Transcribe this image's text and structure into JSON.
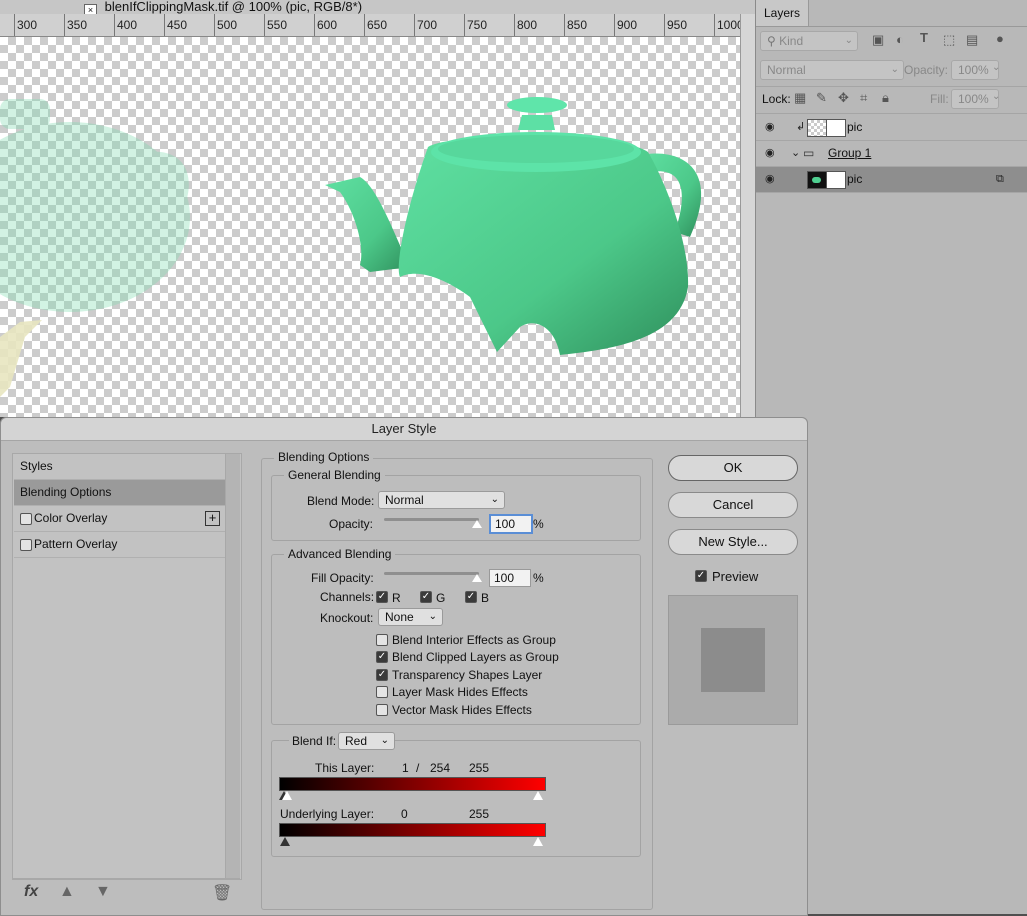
{
  "document": {
    "title": "blenIfClippingMask.tif @ 100% (pic, RGB/8*)"
  },
  "ruler": {
    "ticks": [
      "300",
      "350",
      "400",
      "450",
      "500",
      "550",
      "600",
      "650",
      "700",
      "750",
      "800",
      "850",
      "900",
      "950",
      "1000"
    ]
  },
  "layers_panel": {
    "tab": "Layers",
    "filter_kind": "Kind",
    "blend_mode": "Normal",
    "opacity_label": "Opacity:",
    "opacity_value": "100%",
    "lock_label": "Lock:",
    "fill_label": "Fill:",
    "fill_value": "100%",
    "layers": [
      {
        "name": "pic",
        "clipped": true
      },
      {
        "name": "Group 1",
        "is_group": true
      },
      {
        "name": "pic",
        "selected": true
      }
    ]
  },
  "dialog": {
    "title": "Layer Style",
    "styles": [
      {
        "label": "Styles"
      },
      {
        "label": "Blending Options",
        "selected": true
      },
      {
        "label": "Color Overlay",
        "checked": false
      },
      {
        "label": "Pattern Overlay",
        "checked": false
      }
    ],
    "blending_options": {
      "header": "Blending Options",
      "general": {
        "legend": "General Blending",
        "blend_mode_label": "Blend Mode:",
        "blend_mode": "Normal",
        "opacity_label": "Opacity:",
        "opacity": "100",
        "unit": "%"
      },
      "advanced": {
        "legend": "Advanced Blending",
        "fill_label": "Fill Opacity:",
        "fill": "100",
        "unit": "%",
        "channels_label": "Channels:",
        "channels": [
          "R",
          "G",
          "B"
        ],
        "knockout_label": "Knockout:",
        "knockout": "None",
        "options": [
          {
            "label": "Blend Interior Effects as Group",
            "checked": false
          },
          {
            "label": "Blend Clipped Layers as Group",
            "checked": true
          },
          {
            "label": "Transparency Shapes Layer",
            "checked": true
          },
          {
            "label": "Layer Mask Hides Effects",
            "checked": false
          },
          {
            "label": "Vector Mask Hides Effects",
            "checked": false
          }
        ]
      },
      "blend_if": {
        "label": "Blend If:",
        "channel": "Red",
        "this_layer_label": "This Layer:",
        "this_layer_low": "1",
        "separator": "/",
        "this_layer_split": "254",
        "this_layer_high": "255",
        "underlying_label": "Underlying Layer:",
        "underlying_low": "0",
        "underlying_high": "255"
      }
    },
    "buttons": {
      "ok": "OK",
      "cancel": "Cancel",
      "new_style": "New Style..."
    },
    "preview_label": "Preview",
    "preview_checked": true
  },
  "colors": {
    "teapot": "#4fcf90",
    "accent_red": "#ff0000"
  }
}
